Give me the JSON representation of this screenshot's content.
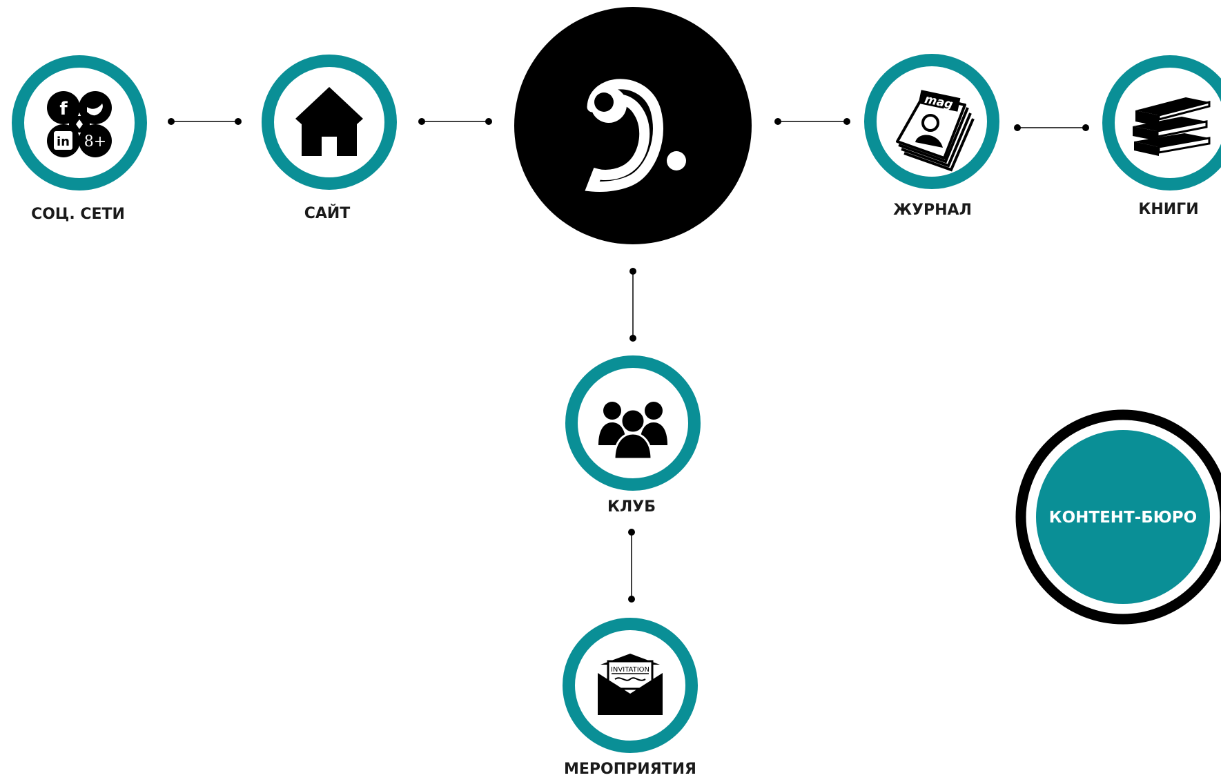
{
  "colors": {
    "accent": "#0a8f96",
    "ink": "#000000",
    "background": "#ffffff",
    "hub_text": "#ffffff"
  },
  "center": {
    "icon": "brand-logo"
  },
  "nodes": {
    "social": {
      "label": "СОЦ. СЕТИ",
      "icon": "social-networks-icon",
      "glyphs": [
        "f",
        "in",
        "8+"
      ]
    },
    "site": {
      "label": "САЙТ",
      "icon": "home-icon"
    },
    "magazine": {
      "label": "ЖУРНАЛ",
      "icon": "magazine-icon",
      "cover_text": "mag"
    },
    "books": {
      "label": "КНИГИ",
      "icon": "books-icon"
    },
    "club": {
      "label": "КЛУБ",
      "icon": "people-icon"
    },
    "events": {
      "label": "МЕРОПРИЯТИЯ",
      "icon": "invitation-envelope-icon",
      "card_text": "INVITATION"
    }
  },
  "hub": {
    "label": "КОНТЕНТ-БЮРО"
  }
}
